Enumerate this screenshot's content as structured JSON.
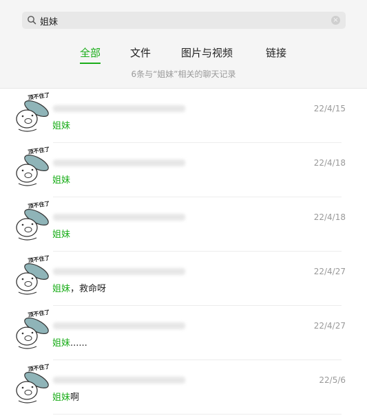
{
  "search": {
    "value": "姐妹",
    "clear_label": "×"
  },
  "tabs": [
    {
      "label": "全部",
      "active": true
    },
    {
      "label": "文件",
      "active": false
    },
    {
      "label": "图片与视频",
      "active": false
    },
    {
      "label": "链接",
      "active": false
    }
  ],
  "summary": "6条与“姐妹”相关的聊天记录",
  "avatar_caption": "顶不住了",
  "results": [
    {
      "date": "22/4/15",
      "highlight": "姐妹",
      "rest": ""
    },
    {
      "date": "22/4/18",
      "highlight": "姐妹",
      "rest": ""
    },
    {
      "date": "22/4/18",
      "highlight": "姐妹",
      "rest": ""
    },
    {
      "date": "22/4/27",
      "highlight": "姐妹",
      "rest": "，救命呀"
    },
    {
      "date": "22/4/27",
      "highlight": "姐妹",
      "rest": "......"
    },
    {
      "date": "22/5/6",
      "highlight": "姐妹",
      "rest": "啊"
    }
  ],
  "colors": {
    "accent": "#1aad19",
    "muted": "#999999"
  }
}
